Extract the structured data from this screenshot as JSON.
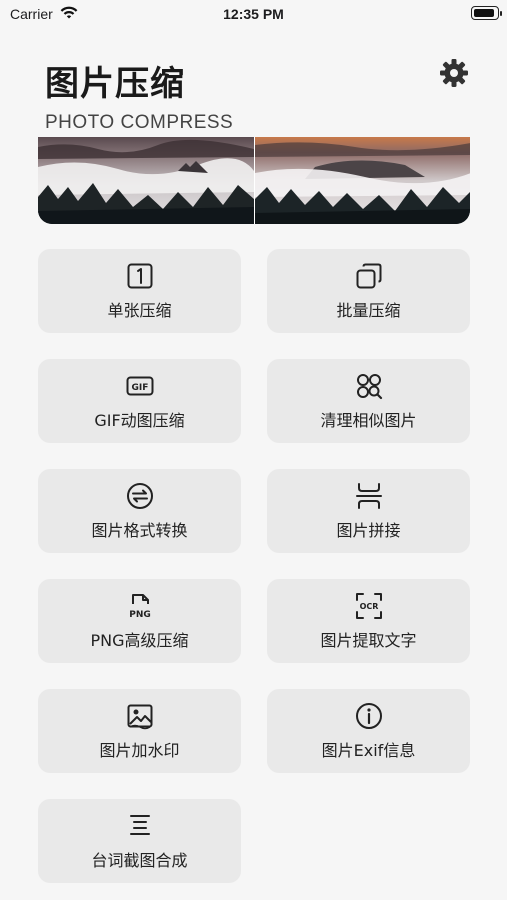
{
  "status_bar": {
    "carrier": "Carrier",
    "time": "12:35 PM",
    "battery_level": 0.95
  },
  "header": {
    "title": "图片压缩",
    "subtitle": "PHOTO COMPRESS",
    "settings_icon": "gear-icon"
  },
  "tools": [
    {
      "label": "单张压缩",
      "icon": "single-image-icon"
    },
    {
      "label": "批量压缩",
      "icon": "stacked-images-icon"
    },
    {
      "label": "GIF动图压缩",
      "icon": "gif-icon",
      "icon_text": "GIF"
    },
    {
      "label": "清理相似图片",
      "icon": "similar-search-icon"
    },
    {
      "label": "图片格式转换",
      "icon": "convert-arrows-icon"
    },
    {
      "label": "图片拼接",
      "icon": "stitch-icon"
    },
    {
      "label": "PNG高级压缩",
      "icon": "png-file-icon",
      "icon_text": "PNG"
    },
    {
      "label": "图片提取文字",
      "icon": "ocr-scan-icon",
      "icon_text": "OCR"
    },
    {
      "label": "图片加水印",
      "icon": "watermark-image-icon"
    },
    {
      "label": "图片Exif信息",
      "icon": "info-icon"
    },
    {
      "label": "台词截图合成",
      "icon": "subtitle-lines-icon"
    }
  ]
}
